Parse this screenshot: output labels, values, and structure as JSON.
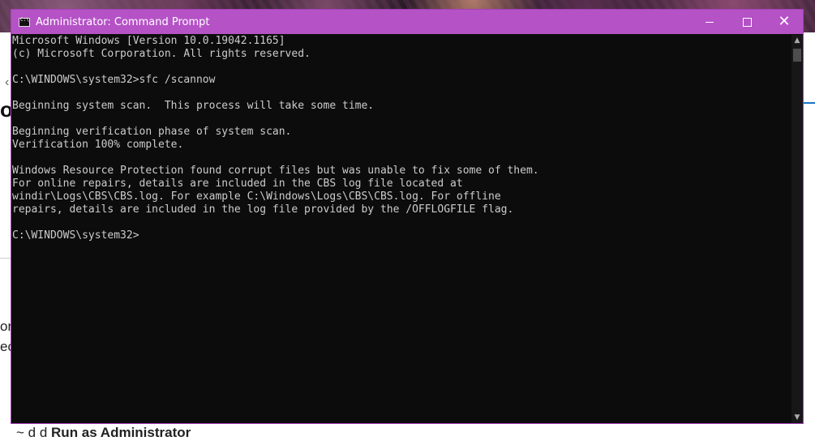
{
  "window": {
    "title": "Administrator: Command Prompt",
    "accent_color": "#b552c6",
    "controls": {
      "minimize": "minimize-icon",
      "maximize": "maximize-icon",
      "close": "close-icon"
    }
  },
  "console": {
    "lines": [
      "Microsoft Windows [Version 10.0.19042.1165]",
      "(c) Microsoft Corporation. All rights reserved.",
      "",
      "C:\\WINDOWS\\system32>sfc /scannow",
      "",
      "Beginning system scan.  This process will take some time.",
      "",
      "Beginning verification phase of system scan.",
      "Verification 100% complete.",
      "",
      "Windows Resource Protection found corrupt files but was unable to fix some of them.",
      "For online repairs, details are included in the CBS log file located at",
      "windir\\Logs\\CBS\\CBS.log. For example C:\\Windows\\Logs\\CBS\\CBS.log. For offline",
      "repairs, details are included in the log file provided by the /OFFLOGFILE flag.",
      "",
      "C:\\WINDOWS\\system32>"
    ]
  },
  "background_page": {
    "heading_fragment": "or",
    "text_fragment_1": "or",
    "text_fragment_2": "ec",
    "bottom_fragment_plain": "~ d d",
    "bottom_fragment_bold": "Run as Administrator"
  }
}
